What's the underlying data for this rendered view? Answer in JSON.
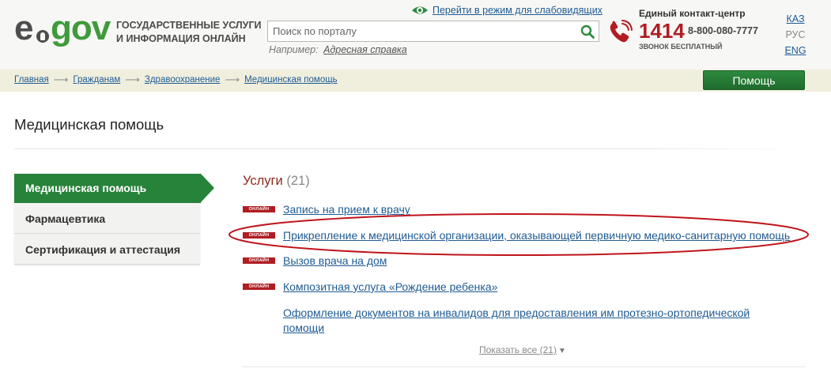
{
  "header": {
    "logo_e": "e",
    "logo_gov": "gov",
    "tagline": "Государственные услуги и информация онлайн",
    "low_vision_link": "Перейти в режим для слабовидящих",
    "search_placeholder": "Поиск по порталу",
    "example_label": "Например:",
    "example_link": "Адресная справка",
    "contact_title": "Единый контакт-центр",
    "contact_short": "1414",
    "contact_phone": "8-800-080-7777",
    "contact_free": "звонок бесплатный",
    "langs": [
      "КАЗ",
      "РУС",
      "ENG"
    ]
  },
  "breadcrumb": [
    "Главная",
    "Гражданам",
    "Здравоохранение",
    "Медицинская помощь"
  ],
  "breadcrumb_sep": "⟶",
  "help_button": "Помощь",
  "page_title": "Медицинская помощь",
  "sidebar": {
    "items": [
      "Медицинская помощь",
      "Фармацевтика",
      "Сертификация и аттестация"
    ],
    "active_index": 0
  },
  "services": {
    "title": "Услуги",
    "count": "(21)",
    "badge": "ОНЛАЙН",
    "items": [
      {
        "label": "Запись на прием к врачу",
        "online": true
      },
      {
        "label": "Прикрепление к медицинской организации, оказывающей первичную медико-санитарную помощь",
        "online": true
      },
      {
        "label": "Вызов врача на дом",
        "online": true
      },
      {
        "label": "Композитная услуга «Рождение ребенка»",
        "online": true
      },
      {
        "label": "Оформление документов на инвалидов для предоставления им протезно-ортопедической помощи",
        "online": false
      }
    ],
    "show_all": "Показать все (21)",
    "show_all_arrow": "▼"
  },
  "colors": {
    "brand_green": "#27823a",
    "accent_red": "#b01d22",
    "link_blue": "#1f5b93",
    "annotation_red": "#c0141c"
  }
}
